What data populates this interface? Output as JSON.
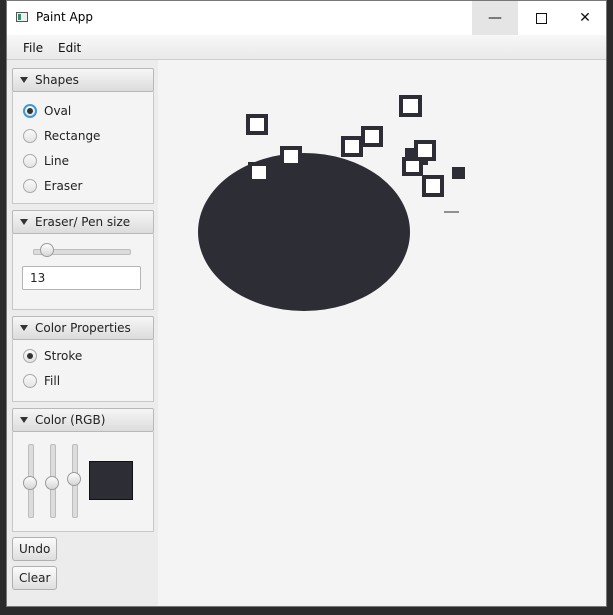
{
  "window": {
    "title": "Paint App"
  },
  "menu": {
    "items": [
      "File",
      "Edit"
    ]
  },
  "shapes_pane": {
    "title": "Shapes",
    "options": [
      {
        "label": "Oval",
        "selected": true
      },
      {
        "label": "Rectange",
        "selected": false
      },
      {
        "label": "Line",
        "selected": false
      },
      {
        "label": "Eraser",
        "selected": false
      }
    ]
  },
  "size_pane": {
    "title": "Eraser/ Pen size",
    "slider_value": 13,
    "field_value": "13"
  },
  "color_props_pane": {
    "title": "Color Properties",
    "options": [
      {
        "label": "Stroke",
        "selected": true
      },
      {
        "label": "Fill",
        "selected": false
      }
    ]
  },
  "rgb_pane": {
    "title": "Color (RGB)",
    "preview_color": "#2d2d35"
  },
  "buttons": {
    "undo": "Undo",
    "clear": "Clear"
  },
  "canvas": {
    "draw_color": "#2d2d35"
  },
  "icons": [
    "app-icon",
    "minimize-icon",
    "maximize-icon",
    "close-icon",
    "triangle-down-icon"
  ]
}
